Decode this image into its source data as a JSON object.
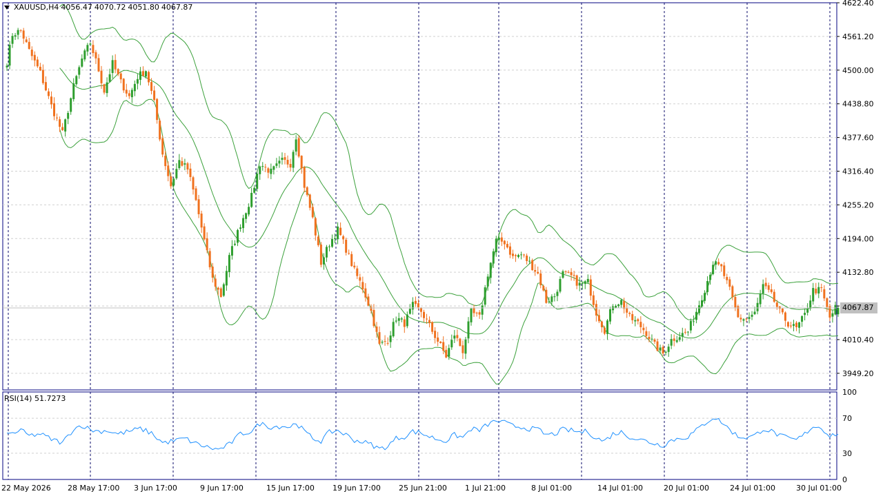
{
  "chart_data": {
    "type": "candlestick",
    "symbol_label": "XAUUSD,H4",
    "ohlc": {
      "open": "4056.47",
      "high": "4070.72",
      "low": "4051.80",
      "close": "4067.87"
    },
    "current_price": "4067.87",
    "price_axis": {
      "ylim": [
        3919,
        4622.4
      ],
      "ticks": [
        "4622.40",
        "4561.20",
        "4500.00",
        "4438.80",
        "4377.60",
        "4316.40",
        "4255.20",
        "4194.00",
        "4132.80",
        "4071.60",
        "4010.40",
        "3949.20"
      ]
    },
    "time_axis": {
      "ticks": [
        "22 May 2026",
        "28 May 17:00",
        "3 Jun 17:00",
        "9 Jun 17:00",
        "15 Jun 17:00",
        "19 Jun 17:00",
        "25 Jun 21:00",
        "1 Jul 21:00",
        "8 Jul 01:00",
        "14 Jul 01:00",
        "20 Jul 01:00",
        "24 Jul 01:00",
        "30 Jul 01:00"
      ]
    },
    "close_anchors": [
      [
        0,
        4515
      ],
      [
        2,
        4565
      ],
      [
        5,
        4572
      ],
      [
        8,
        4535
      ],
      [
        12,
        4495
      ],
      [
        16,
        4435
      ],
      [
        20,
        4385
      ],
      [
        24,
        4470
      ],
      [
        27,
        4520
      ],
      [
        30,
        4550
      ],
      [
        33,
        4500
      ],
      [
        35,
        4462
      ],
      [
        38,
        4512
      ],
      [
        41,
        4478
      ],
      [
        44,
        4452
      ],
      [
        47,
        4488
      ],
      [
        50,
        4500
      ],
      [
        53,
        4440
      ],
      [
        56,
        4348
      ],
      [
        59,
        4290
      ],
      [
        62,
        4335
      ],
      [
        65,
        4320
      ],
      [
        68,
        4262
      ],
      [
        71,
        4190
      ],
      [
        74,
        4120
      ],
      [
        77,
        4090
      ],
      [
        80,
        4160
      ],
      [
        84,
        4220
      ],
      [
        88,
        4270
      ],
      [
        91,
        4330
      ],
      [
        95,
        4315
      ],
      [
        99,
        4335
      ],
      [
        102,
        4330
      ],
      [
        104,
        4380
      ],
      [
        107,
        4290
      ],
      [
        110,
        4230
      ],
      [
        113,
        4150
      ],
      [
        116,
        4185
      ],
      [
        119,
        4210
      ],
      [
        122,
        4175
      ],
      [
        125,
        4135
      ],
      [
        128,
        4105
      ],
      [
        131,
        4062
      ],
      [
        134,
        4000
      ],
      [
        137,
        4010
      ],
      [
        140,
        4050
      ],
      [
        143,
        4040
      ],
      [
        146,
        4072
      ],
      [
        149,
        4062
      ],
      [
        152,
        4035
      ],
      [
        155,
        4008
      ],
      [
        158,
        3980
      ],
      [
        161,
        4020
      ],
      [
        164,
        3990
      ],
      [
        167,
        4060
      ],
      [
        170,
        4050
      ],
      [
        173,
        4130
      ],
      [
        176,
        4190
      ],
      [
        179,
        4188
      ],
      [
        182,
        4160
      ],
      [
        185,
        4165
      ],
      [
        188,
        4150
      ],
      [
        191,
        4130
      ],
      [
        194,
        4080
      ],
      [
        197,
        4090
      ],
      [
        200,
        4130
      ],
      [
        203,
        4125
      ],
      [
        206,
        4110
      ],
      [
        209,
        4115
      ],
      [
        212,
        4060
      ],
      [
        215,
        4028
      ],
      [
        218,
        4075
      ],
      [
        221,
        4080
      ],
      [
        224,
        4050
      ],
      [
        227,
        4040
      ],
      [
        230,
        4023
      ],
      [
        233,
        4000
      ],
      [
        236,
        3985
      ],
      [
        239,
        4010
      ],
      [
        242,
        4018
      ],
      [
        245,
        4025
      ],
      [
        248,
        4062
      ],
      [
        251,
        4102
      ],
      [
        254,
        4150
      ],
      [
        257,
        4140
      ],
      [
        260,
        4100
      ],
      [
        263,
        4050
      ],
      [
        266,
        4048
      ],
      [
        269,
        4058
      ],
      [
        272,
        4108
      ],
      [
        275,
        4090
      ],
      [
        278,
        4060
      ],
      [
        281,
        4040
      ],
      [
        284,
        4030
      ],
      [
        287,
        4055
      ],
      [
        290,
        4100
      ],
      [
        293,
        4100
      ],
      [
        296,
        4050
      ],
      [
        298,
        4068
      ]
    ],
    "rsi_anchors": [
      [
        0,
        51
      ],
      [
        5,
        56
      ],
      [
        8,
        50
      ],
      [
        12,
        52
      ],
      [
        16,
        46
      ],
      [
        20,
        42
      ],
      [
        24,
        58
      ],
      [
        27,
        62
      ],
      [
        30,
        57
      ],
      [
        33,
        55
      ],
      [
        36,
        56
      ],
      [
        40,
        52
      ],
      [
        44,
        55
      ],
      [
        48,
        58
      ],
      [
        52,
        53
      ],
      [
        56,
        42
      ],
      [
        60,
        44
      ],
      [
        64,
        47
      ],
      [
        68,
        41
      ],
      [
        72,
        37
      ],
      [
        76,
        34
      ],
      [
        80,
        40
      ],
      [
        84,
        52
      ],
      [
        88,
        55
      ],
      [
        91,
        64
      ],
      [
        95,
        60
      ],
      [
        99,
        61
      ],
      [
        102,
        60
      ],
      [
        104,
        65
      ],
      [
        107,
        55
      ],
      [
        110,
        47
      ],
      [
        113,
        44
      ],
      [
        116,
        54
      ],
      [
        119,
        56
      ],
      [
        122,
        51
      ],
      [
        125,
        45
      ],
      [
        128,
        43
      ],
      [
        131,
        40
      ],
      [
        134,
        35
      ],
      [
        137,
        38
      ],
      [
        140,
        47
      ],
      [
        143,
        49
      ],
      [
        146,
        55
      ],
      [
        149,
        53
      ],
      [
        152,
        49
      ],
      [
        155,
        46
      ],
      [
        158,
        44
      ],
      [
        161,
        51
      ],
      [
        164,
        48
      ],
      [
        167,
        58
      ],
      [
        170,
        56
      ],
      [
        173,
        63
      ],
      [
        176,
        67
      ],
      [
        179,
        65
      ],
      [
        182,
        61
      ],
      [
        185,
        60
      ],
      [
        188,
        58
      ],
      [
        191,
        57
      ],
      [
        194,
        51
      ],
      [
        197,
        52
      ],
      [
        200,
        57
      ],
      [
        203,
        56
      ],
      [
        206,
        54
      ],
      [
        209,
        55
      ],
      [
        212,
        47
      ],
      [
        215,
        44
      ],
      [
        218,
        52
      ],
      [
        221,
        54
      ],
      [
        224,
        49
      ],
      [
        227,
        46
      ],
      [
        230,
        44
      ],
      [
        233,
        41
      ],
      [
        236,
        39
      ],
      [
        239,
        45
      ],
      [
        242,
        47
      ],
      [
        245,
        49
      ],
      [
        248,
        56
      ],
      [
        251,
        64
      ],
      [
        254,
        71
      ],
      [
        257,
        66
      ],
      [
        260,
        57
      ],
      [
        263,
        49
      ],
      [
        266,
        48
      ],
      [
        269,
        50
      ],
      [
        272,
        58
      ],
      [
        275,
        55
      ],
      [
        278,
        50
      ],
      [
        281,
        47
      ],
      [
        284,
        45
      ],
      [
        287,
        52
      ],
      [
        290,
        61
      ],
      [
        293,
        59
      ],
      [
        296,
        50
      ],
      [
        298,
        52
      ]
    ],
    "bollinger": {
      "period": 20,
      "deviations": 2
    },
    "rsi": {
      "label": "RSI(14) 51.7273",
      "ticks": [
        "100",
        "70",
        "30",
        "0"
      ],
      "ylim": [
        0,
        100
      ]
    },
    "colors": {
      "bull": "#2e9e2e",
      "bear": "#f0711e",
      "band": "#3aa03a",
      "rsi": "#1e90ff",
      "grid": "#d0d0d0",
      "vline": "#0a0a6a",
      "axis": "#000080"
    }
  }
}
